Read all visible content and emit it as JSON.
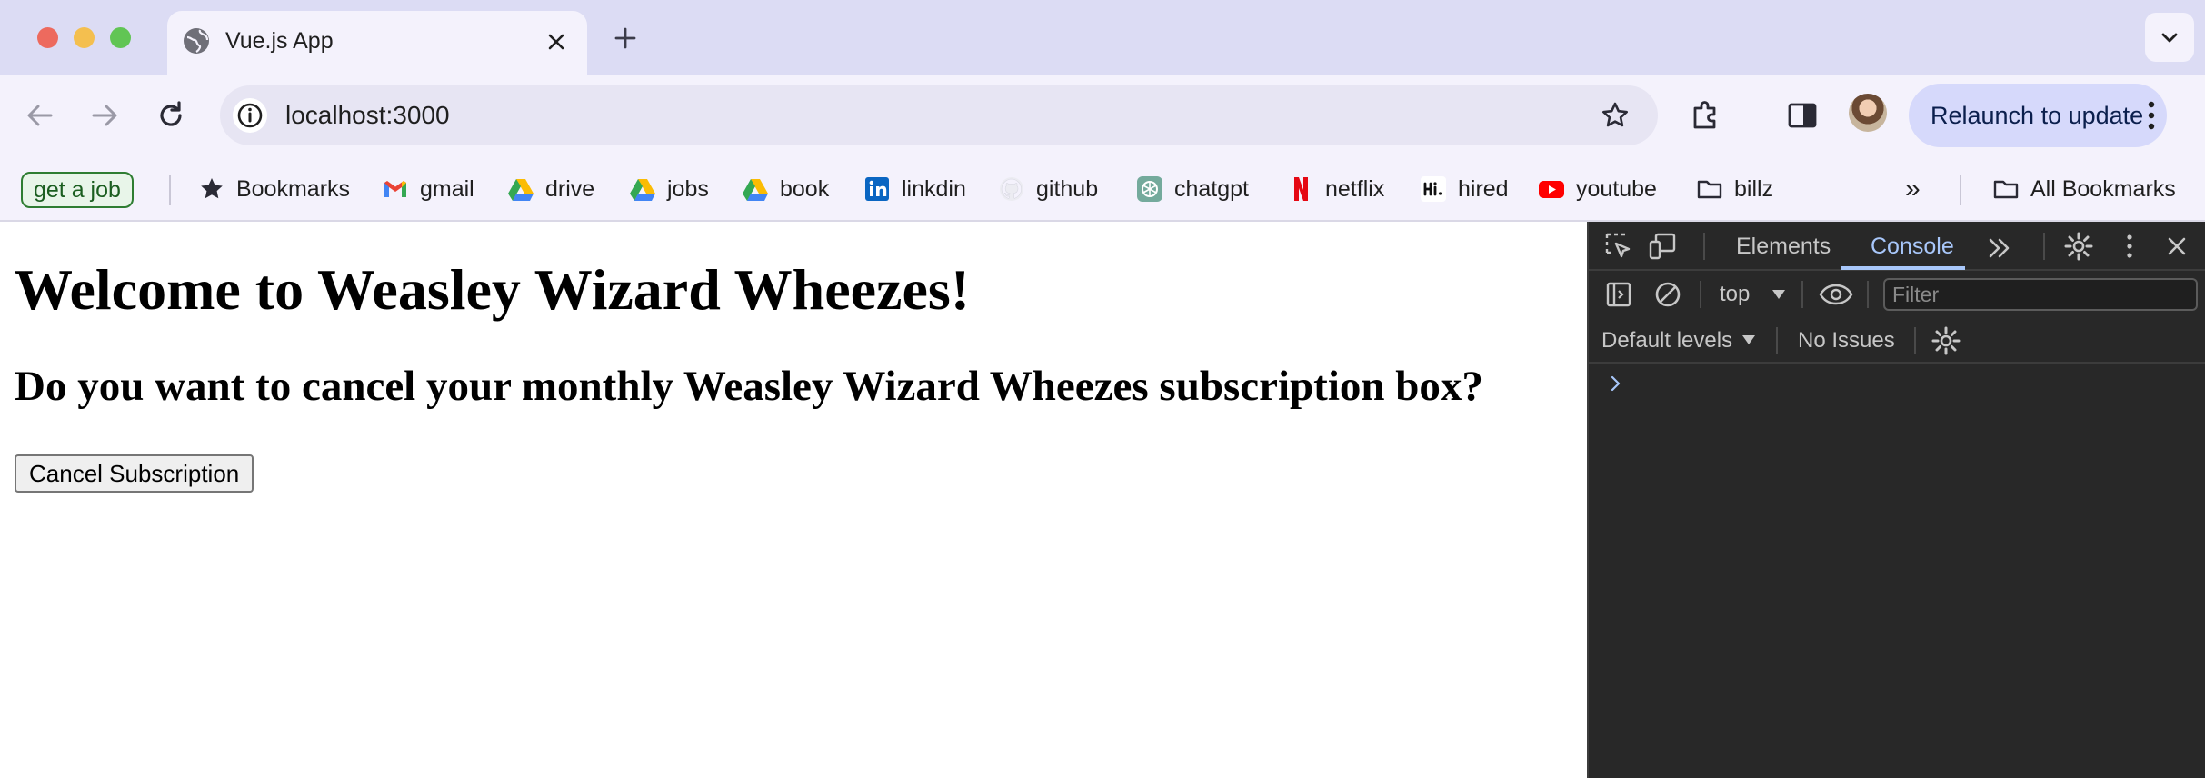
{
  "browser": {
    "tab": {
      "title": "Vue.js App"
    },
    "address_bar": {
      "host": "localhost",
      "port": ":3000"
    },
    "relaunch_label": "Relaunch to update"
  },
  "bookmarks": {
    "get_a_job": "get a job",
    "items": [
      {
        "label": "Bookmarks",
        "icon": "star-icon"
      },
      {
        "label": "gmail",
        "icon": "gmail-icon"
      },
      {
        "label": "drive",
        "icon": "google-drive-icon"
      },
      {
        "label": "jobs",
        "icon": "google-drive-icon"
      },
      {
        "label": "book",
        "icon": "google-drive-icon"
      },
      {
        "label": "linkdin",
        "icon": "linkedin-icon"
      },
      {
        "label": "github",
        "icon": "github-icon"
      },
      {
        "label": "chatgpt",
        "icon": "chatgpt-icon"
      },
      {
        "label": "netflix",
        "icon": "netflix-icon"
      },
      {
        "label": "hired",
        "icon": "hired-icon"
      },
      {
        "label": "youtube",
        "icon": "youtube-icon"
      },
      {
        "label": "billz",
        "icon": "folder-icon"
      }
    ],
    "overflow_label": "»",
    "all_bookmarks": "All Bookmarks"
  },
  "page": {
    "heading": "Welcome to Weasley Wizard Wheezes!",
    "subheading": "Do you want to cancel your monthly Weasley Wizard Wheezes subscription box?",
    "cancel_button": "Cancel Subscription"
  },
  "devtools": {
    "tabs": {
      "elements": "Elements",
      "console": "Console",
      "active": "Console"
    },
    "context": "top",
    "filter_placeholder": "Filter",
    "levels": "Default levels",
    "issues": "No Issues"
  },
  "colors": {
    "tabstrip": "#dcdcf4",
    "toolbar": "#f4f2fc",
    "relaunch_bg": "#d6d9fb",
    "devtools_bg": "#282828",
    "devtools_accent": "#a8c7fa"
  }
}
